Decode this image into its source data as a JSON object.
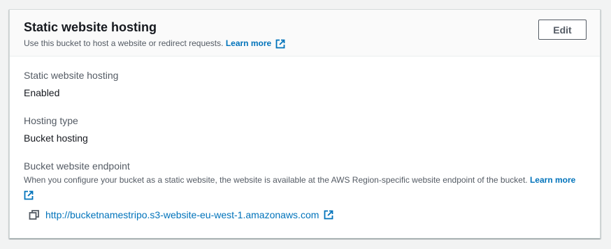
{
  "panel": {
    "title": "Static website hosting",
    "description": "Use this bucket to host a website or redirect requests.",
    "learn_more": "Learn more",
    "edit_label": "Edit"
  },
  "fields": {
    "hosting": {
      "label": "Static website hosting",
      "value": "Enabled"
    },
    "hosting_type": {
      "label": "Hosting type",
      "value": "Bucket hosting"
    },
    "endpoint": {
      "label": "Bucket website endpoint",
      "description": "When you configure your bucket as a static website, the website is available at the AWS Region-specific website endpoint of the bucket.",
      "learn_more": "Learn more",
      "url": "http://bucketnamestripo.s3-website-eu-west-1.amazonaws.com"
    }
  },
  "icons": {
    "external_link": "external-link-icon",
    "copy": "copy-icon"
  },
  "colors": {
    "link": "#0073bb",
    "text": "#16191f",
    "muted": "#545b64"
  }
}
